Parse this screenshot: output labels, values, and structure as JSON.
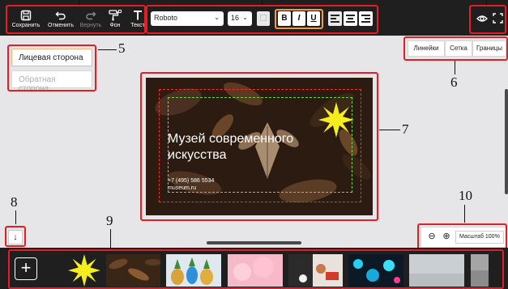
{
  "toolbar": {
    "save": "Сохранить",
    "undo": "Отменить",
    "redo": "Вернуть",
    "background": "Фон",
    "text": "Текст",
    "font": "Roboto",
    "size": "16",
    "bold": "B",
    "italic": "I",
    "underline": "U"
  },
  "sides": {
    "front": "Лицевая сторона",
    "back": "Обратная сторона"
  },
  "toggles": {
    "rulers": "Линейки",
    "grid": "Сетка",
    "bounds": "Границы"
  },
  "card": {
    "title": "Музей современного искусства",
    "phone": "+7 (495) 586 5534",
    "site": "museum.ru"
  },
  "zoom": {
    "label": "Масштаб 100%"
  },
  "callouts": {
    "n5": "5",
    "n6": "6",
    "n7": "7",
    "n8": "8",
    "n9": "9",
    "n10": "10"
  },
  "colors": {
    "highlight": "#e31e24",
    "toolbar": "#1f1f1f",
    "workspace": "#e6e6e8",
    "star": "#f5ee1f",
    "guide_outer": "#ff2a2a",
    "guide_inner": "#6bd84b"
  }
}
